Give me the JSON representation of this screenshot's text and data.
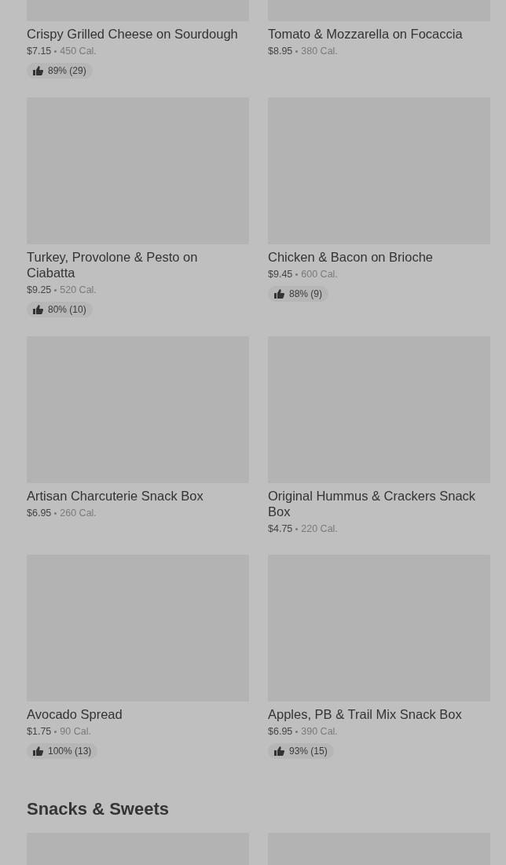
{
  "sections": [
    {
      "items": [
        {
          "kind": "product",
          "name": "Crispy Grilled Cheese on Sourdough",
          "price": "$7.15",
          "calories": "450 Cal.",
          "rating": "89% (29)"
        },
        {
          "kind": "product",
          "name": "Tomato & Mozzarella on Focaccia",
          "price": "$8.95",
          "calories": "380 Cal."
        },
        {
          "kind": "product",
          "name": "Turkey, Provolone & Pesto on Ciabatta",
          "price": "$9.25",
          "calories": "520 Cal.",
          "rating": "80% (10)"
        },
        {
          "kind": "product",
          "name": "Chicken & Bacon on Brioche",
          "price": "$9.45",
          "calories": "600 Cal.",
          "rating": "88% (9)"
        },
        {
          "kind": "product",
          "name": "Artisan Charcuterie Snack Box",
          "price": "$6.95",
          "calories": "260 Cal."
        },
        {
          "kind": "product",
          "name": "Original Hummus & Crackers Snack Box",
          "price": "$4.75",
          "calories": "220 Cal."
        },
        {
          "kind": "product",
          "name": "Avocado Spread",
          "price": "$1.75",
          "calories": "90 Cal.",
          "rating": "100% (13)"
        },
        {
          "kind": "product",
          "name": "Apples, PB & Trail Mix Snack Box",
          "price": "$6.95",
          "calories": "390 Cal.",
          "rating": "93% (15)"
        }
      ]
    },
    {
      "heading": "Snacks & Sweets"
    }
  ]
}
